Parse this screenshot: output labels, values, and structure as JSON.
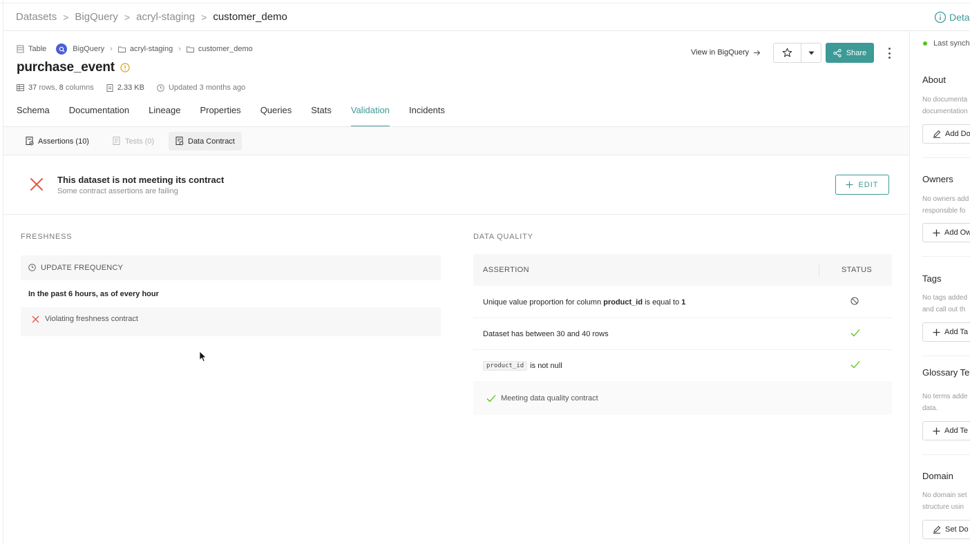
{
  "breadcrumb": {
    "items": [
      "Datasets",
      "BigQuery",
      "acryl-staging"
    ],
    "current": "customer_demo",
    "separator": ">"
  },
  "details_link": {
    "label": "Deta"
  },
  "entity": {
    "type_label": "Table",
    "platform": "BigQuery",
    "container_1": "acryl-staging",
    "container_2": "customer_demo",
    "name": "purchase_event",
    "rows": "37",
    "rows_suffix": "rows,",
    "columns": "8",
    "columns_suffix": "columns",
    "size": "2.33 KB",
    "updated": "Updated 3 months ago"
  },
  "header_actions": {
    "view_in": "View in BigQuery",
    "share": "Share"
  },
  "tabs": [
    {
      "label": "Schema",
      "active": false
    },
    {
      "label": "Documentation",
      "active": false
    },
    {
      "label": "Lineage",
      "active": false
    },
    {
      "label": "Properties",
      "active": false
    },
    {
      "label": "Queries",
      "active": false
    },
    {
      "label": "Stats",
      "active": false
    },
    {
      "label": "Validation",
      "active": true
    },
    {
      "label": "Incidents",
      "active": false
    }
  ],
  "subtabs": {
    "assertions": "Assertions (10)",
    "tests": "Tests (0)",
    "data_contract": "Data Contract"
  },
  "contract_status": {
    "title": "This dataset is not meeting its contract",
    "subtitle": "Some contract assertions are failing",
    "edit_label": "EDIT"
  },
  "freshness": {
    "section_label": "FRESHNESS",
    "header": "UPDATE FREQUENCY",
    "rule": "In the past 6 hours, as of every hour",
    "status": "Violating freshness contract"
  },
  "data_quality": {
    "section_label": "DATA QUALITY",
    "col_assertion": "ASSERTION",
    "col_status": "STATUS",
    "rows": [
      {
        "prefix": "Unique value proportion for column",
        "bold": "product_id",
        "middle": "is equal to",
        "bold2": "1",
        "status": "skipped"
      },
      {
        "text": "Dataset has between 30 and 40 rows",
        "status": "passing"
      },
      {
        "code": "product_id",
        "text": "is not null",
        "status": "passing"
      }
    ],
    "footer": "Meeting data quality contract"
  },
  "sidebar": {
    "sync": "Last synch",
    "about_title": "About",
    "about_desc_1": "No documenta",
    "about_desc_2": "documentation",
    "about_btn": "Add Do",
    "owners_title": "Owners",
    "owners_desc_1": "No owners add",
    "owners_desc_2": "responsible fo",
    "owners_btn": "Add Ow",
    "tags_title": "Tags",
    "tags_desc_1": "No tags added",
    "tags_desc_2": "and call out th",
    "tags_btn": "Add Ta",
    "glossary_title": "Glossary Ter",
    "glossary_desc_1": "No terms adde",
    "glossary_desc_2": "data.",
    "glossary_btn": "Add Te",
    "domain_title": "Domain",
    "domain_desc_1": "No domain set",
    "domain_desc_2": "structure usin",
    "domain_btn": "Set Do"
  },
  "colors": {
    "accent": "#3c9a96",
    "error": "#e05a47",
    "success": "#52c41a",
    "warning": "#d4a017"
  }
}
